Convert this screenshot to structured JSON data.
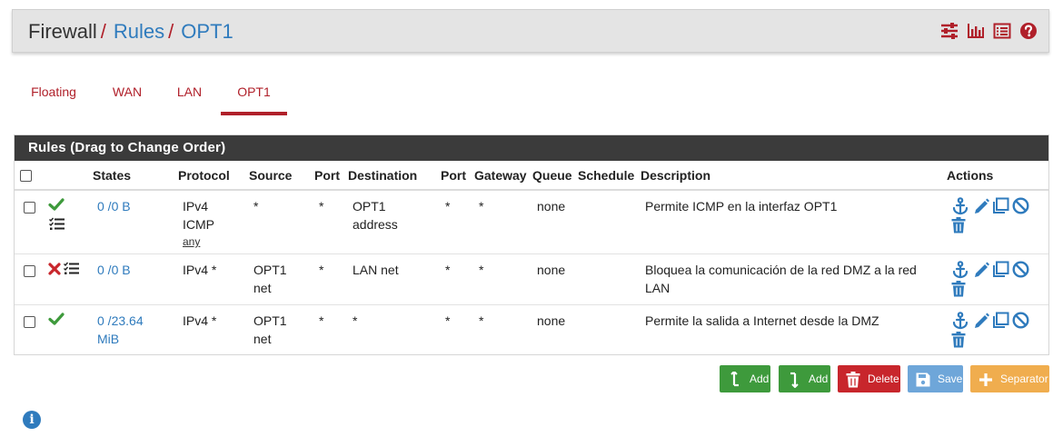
{
  "header": {
    "crumb_firewall": "Firewall",
    "crumb_rules": "Rules",
    "crumb_opt1": "OPT1",
    "separator": "/",
    "icons": [
      "sliders-icon",
      "bar-chart-icon",
      "list-icon",
      "help-icon"
    ]
  },
  "tabs": [
    {
      "label": "Floating",
      "active": false
    },
    {
      "label": "WAN",
      "active": false
    },
    {
      "label": "LAN",
      "active": false
    },
    {
      "label": "OPT1",
      "active": true
    }
  ],
  "panel": {
    "title": "Rules (Drag to Change Order)"
  },
  "columns": {
    "states": "States",
    "protocol": "Protocol",
    "source": "Source",
    "port_src": "Port",
    "destination": "Destination",
    "port_dst": "Port",
    "gateway": "Gateway",
    "queue": "Queue",
    "schedule": "Schedule",
    "description": "Description",
    "actions": "Actions"
  },
  "rows": [
    {
      "status": "pass",
      "states_l1": "0 /0 B",
      "states_l2": "",
      "protocol_l1": "IPv4",
      "protocol_l2": "ICMP",
      "protocol_l3": "any",
      "source_l1": "*",
      "source_l2": "",
      "port_src": "*",
      "dest_l1": "OPT1",
      "dest_l2": "address",
      "port_dst": "*",
      "gateway": "*",
      "queue": "none",
      "schedule": "",
      "desc_l1": "Permite ICMP en la interfaz OPT1",
      "desc_l2": ""
    },
    {
      "status": "block",
      "states_l1": "0 /0 B",
      "states_l2": "",
      "protocol_l1": "IPv4 *",
      "protocol_l2": "",
      "protocol_l3": "",
      "source_l1": "OPT1",
      "source_l2": "net",
      "port_src": "*",
      "dest_l1": "LAN net",
      "dest_l2": "",
      "port_dst": "*",
      "gateway": "*",
      "queue": "none",
      "schedule": "",
      "desc_l1": "Bloquea la comunicación de la red DMZ a la red",
      "desc_l2": "LAN"
    },
    {
      "status": "pass",
      "states_l1": "0 /23.64",
      "states_l2": "MiB",
      "protocol_l1": "IPv4 *",
      "protocol_l2": "",
      "protocol_l3": "",
      "source_l1": "OPT1",
      "source_l2": "net",
      "port_src": "*",
      "dest_l1": "*",
      "dest_l2": "",
      "port_dst": "*",
      "gateway": "*",
      "queue": "none",
      "schedule": "",
      "desc_l1": "Permite la salida a Internet desde la DMZ",
      "desc_l2": ""
    }
  ],
  "buttons": {
    "add_top": "Add",
    "add_bottom": "Add",
    "delete": "Delete",
    "save": "Save",
    "separator": "Separator"
  },
  "colors": {
    "accent_red": "#b0202a",
    "link_blue": "#2f7bbd",
    "success_green": "#3e9a3c",
    "danger_red": "#c8262c",
    "save_blue": "#6ea6d9",
    "separator_orange": "#f0ad4e",
    "title_bar": "#3b3b3b"
  }
}
